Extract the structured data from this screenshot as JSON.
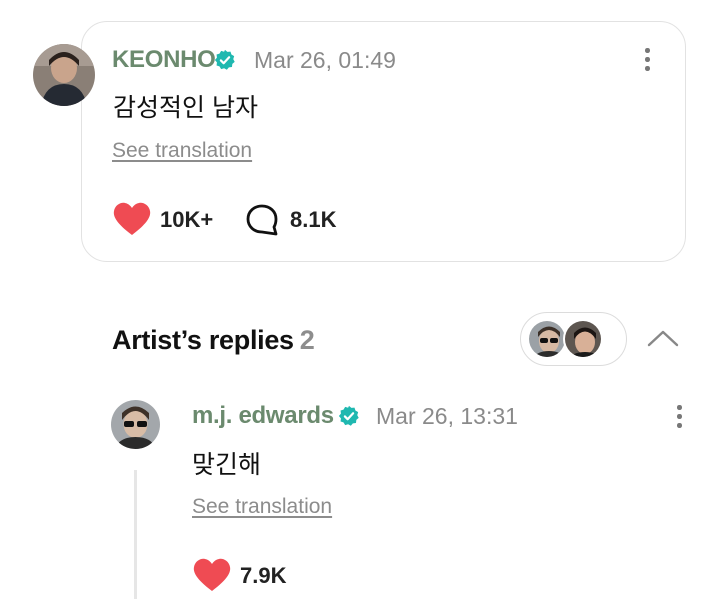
{
  "post": {
    "author": "KEONHO",
    "timestamp": "Mar 26, 01:49",
    "text": "감성적인 남자",
    "translate_label": "See translation",
    "likes": "10K+",
    "comments": "8.1K",
    "accent_color": "#6b8a6e",
    "like_color": "#ef4b53",
    "verified_color": "#1fb8b0"
  },
  "replies_section": {
    "title": "Artist’s replies",
    "count": "2"
  },
  "reply": {
    "author": "m.j. edwards",
    "timestamp": "Mar 26, 13:31",
    "text": "맞긴해",
    "translate_label": "See translation",
    "likes": "7.9K"
  },
  "icons": [
    "verified-badge-icon",
    "more-options-icon",
    "heart-icon",
    "comment-bubble-icon",
    "chevron-up-icon"
  ]
}
